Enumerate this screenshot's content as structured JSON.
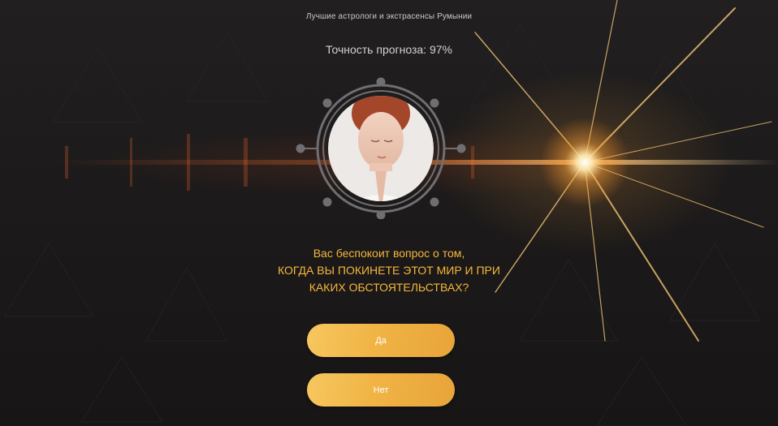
{
  "header": {
    "subtitle": "Лучшие астрологи и экстрасенсы Румынии",
    "accuracy": "Точность прогноза: 97%"
  },
  "question": {
    "line1": "Вас беспокоит вопрос о том,",
    "line2": "КОГДА ВЫ ПОКИНЕТЕ ЭТОТ МИР И ПРИ",
    "line3": "КАКИХ ОБСТОЯТЕЛЬСТВАХ?"
  },
  "buttons": {
    "yes": "Да",
    "no": "Нет"
  },
  "colors": {
    "accent": "#f6b73c",
    "button": "#f0b445",
    "background": "#1c1a1b"
  },
  "icons": {
    "emblem": "astrolabe-frame",
    "portrait": "praying-woman-photo",
    "light": "lens-flare"
  }
}
